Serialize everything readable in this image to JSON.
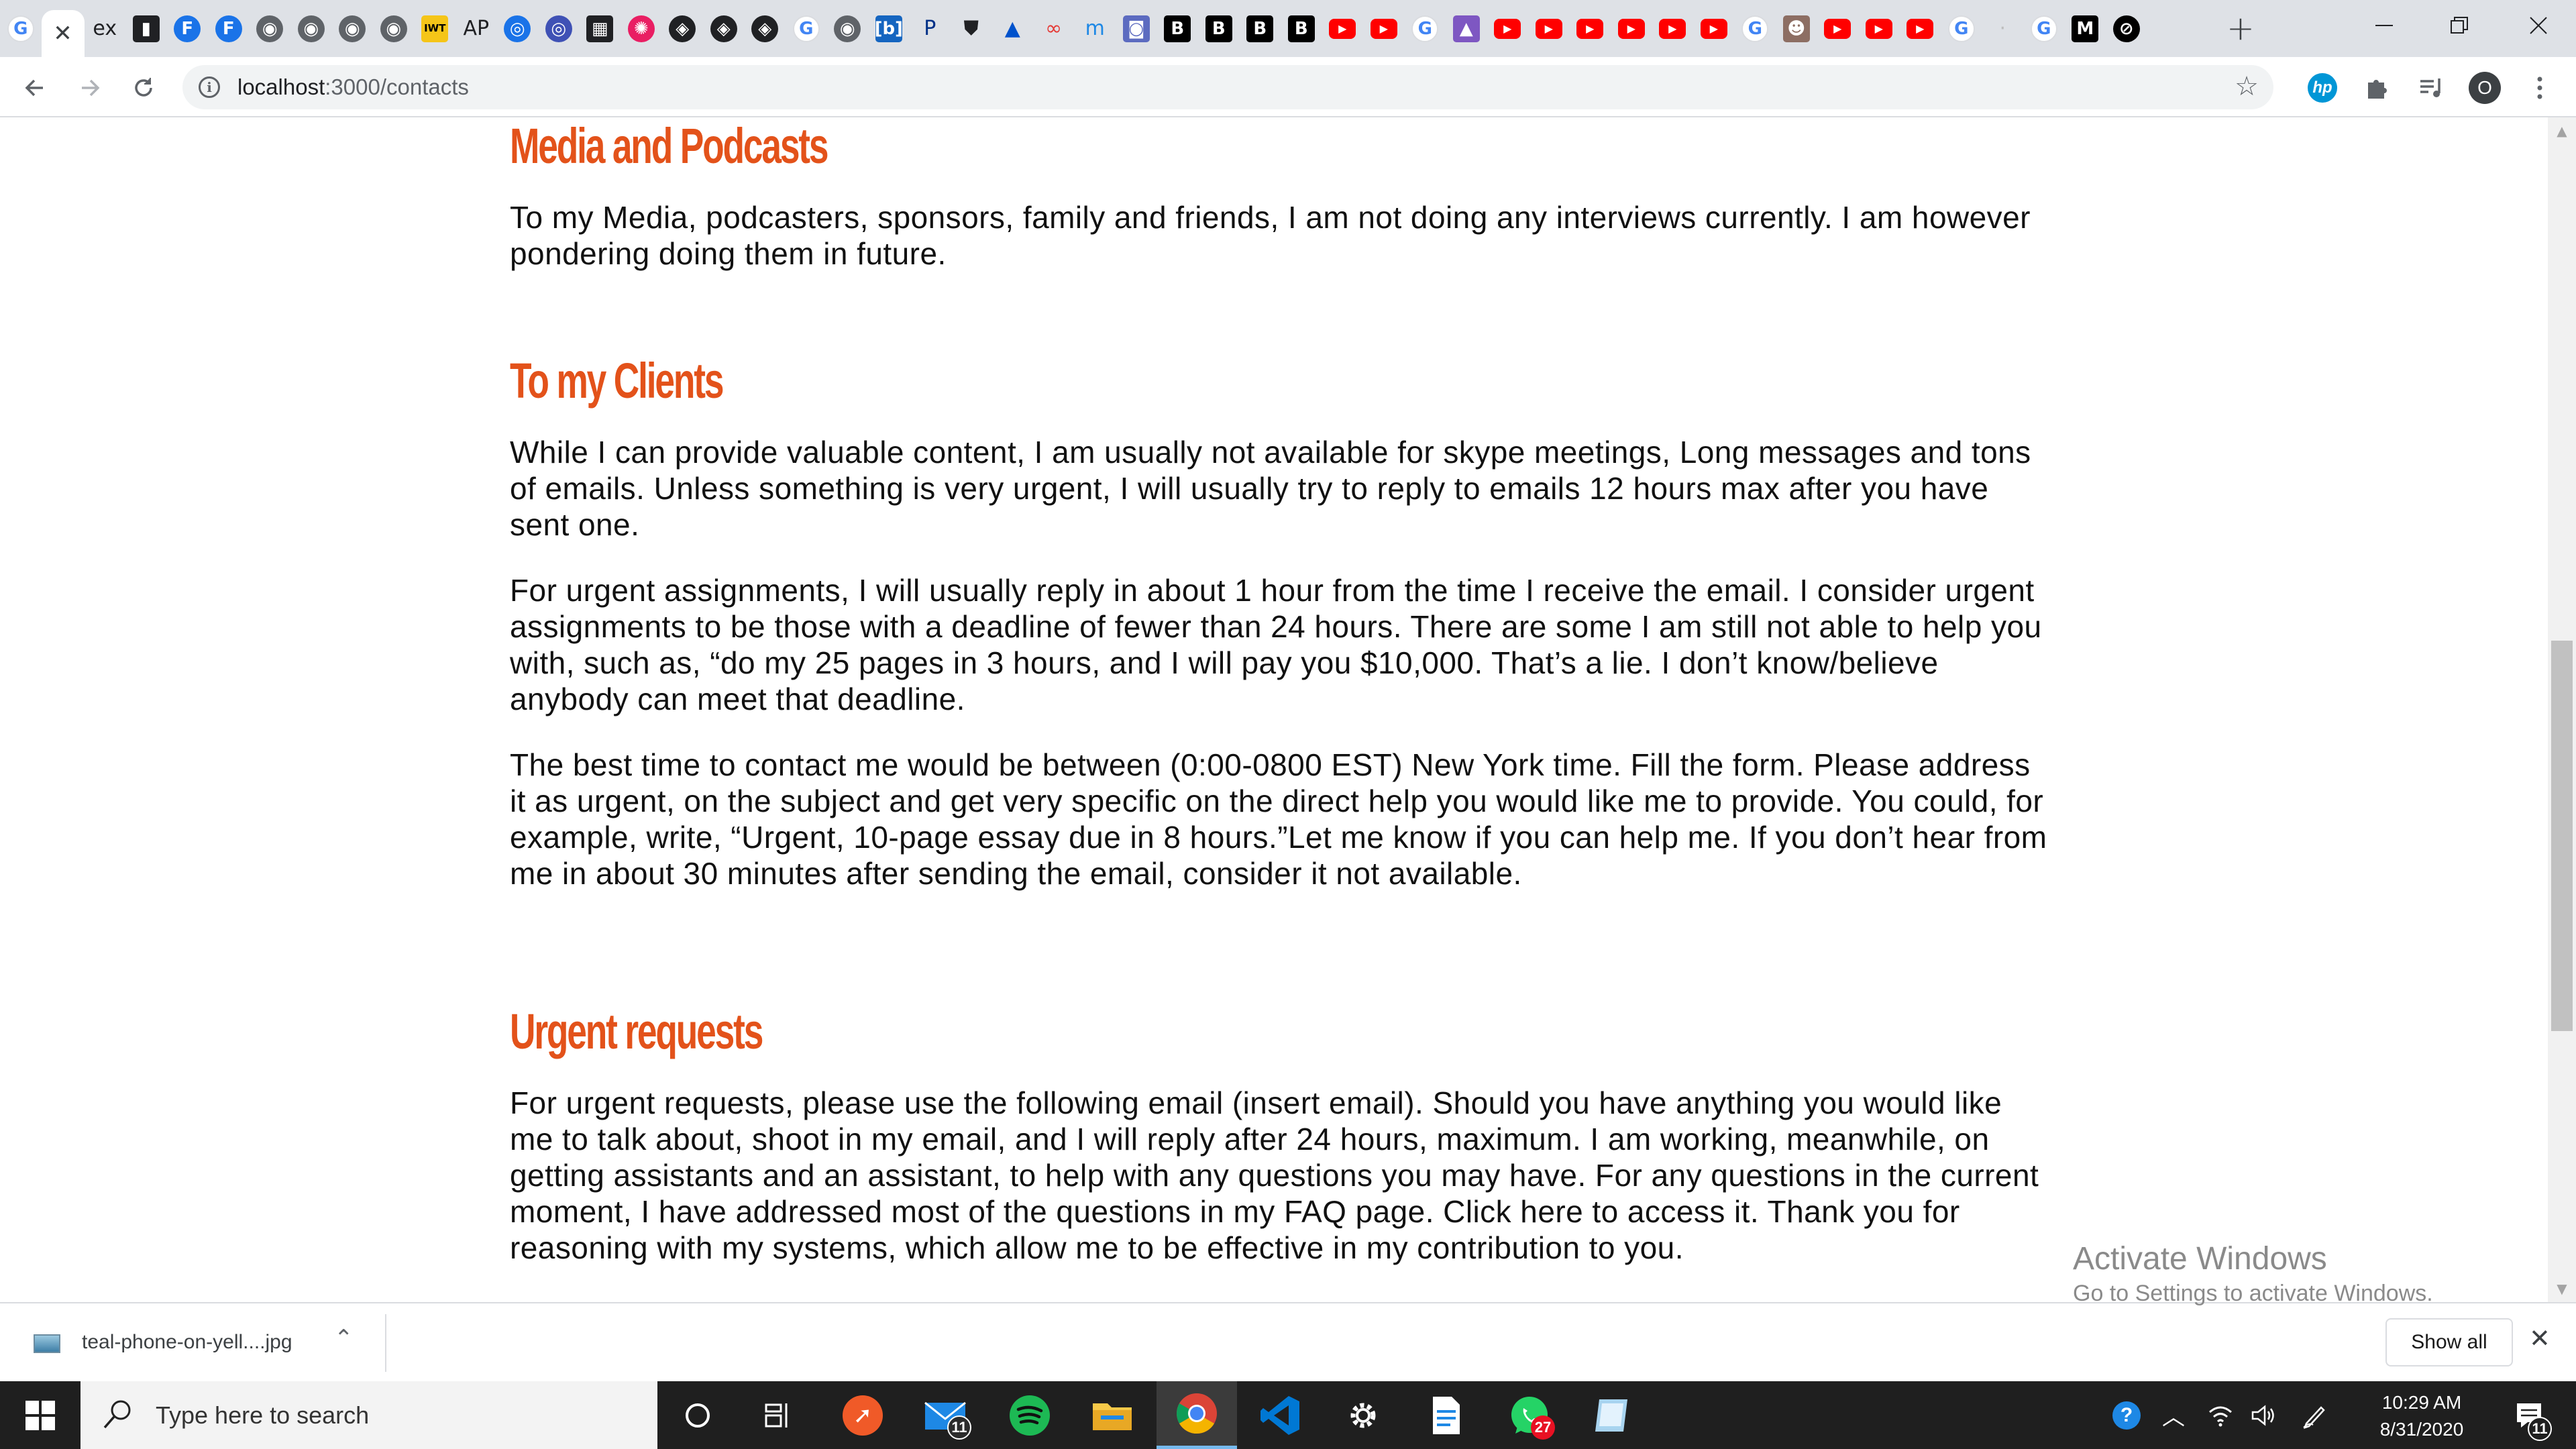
{
  "browser": {
    "tabs": [
      {
        "favicon": "google-icon",
        "glyph": "G",
        "color": "#4285f4",
        "kind": "circle-light"
      },
      {
        "favicon": "close-icon",
        "glyph": "✕",
        "color": "#3c4043",
        "kind": "active"
      },
      {
        "favicon": "ex-icon",
        "glyph": "ex",
        "color": "#202124",
        "kind": "txt"
      },
      {
        "favicon": "bookmark-icon",
        "glyph": "▮",
        "color": "#202124",
        "kind": "sq"
      },
      {
        "favicon": "f-icon",
        "glyph": "F",
        "color": "#1a73e8",
        "kind": "circle"
      },
      {
        "favicon": "f-icon",
        "glyph": "F",
        "color": "#1a73e8",
        "kind": "circle"
      },
      {
        "favicon": "globe-icon",
        "glyph": "◉",
        "color": "#5f6368",
        "kind": "circle"
      },
      {
        "favicon": "globe-icon",
        "glyph": "◉",
        "color": "#5f6368",
        "kind": "circle"
      },
      {
        "favicon": "globe-icon",
        "glyph": "◉",
        "color": "#5f6368",
        "kind": "circle"
      },
      {
        "favicon": "globe-icon",
        "glyph": "◉",
        "color": "#5f6368",
        "kind": "circle"
      },
      {
        "favicon": "iwt-icon",
        "glyph": "IWT",
        "color": "#f5c518",
        "kind": "sq-dark"
      },
      {
        "favicon": "ap-icon",
        "glyph": "AP",
        "color": "#202124",
        "kind": "txt"
      },
      {
        "favicon": "ring-icon",
        "glyph": "◎",
        "color": "#1a73e8",
        "kind": "circle"
      },
      {
        "favicon": "ring-icon",
        "glyph": "◎",
        "color": "#3f51b5",
        "kind": "circle"
      },
      {
        "favicon": "printer-icon",
        "glyph": "▦",
        "color": "#202124",
        "kind": "sq"
      },
      {
        "favicon": "color-wheel-icon",
        "glyph": "✺",
        "color": "#e91e63",
        "kind": "circle"
      },
      {
        "favicon": "codepen-icon",
        "glyph": "◈",
        "color": "#202124",
        "kind": "circle"
      },
      {
        "favicon": "codepen-icon",
        "glyph": "◈",
        "color": "#202124",
        "kind": "circle"
      },
      {
        "favicon": "codepen-icon",
        "glyph": "◈",
        "color": "#202124",
        "kind": "circle"
      },
      {
        "favicon": "google-icon",
        "glyph": "G",
        "color": "#4285f4",
        "kind": "circle-light"
      },
      {
        "favicon": "globe-icon",
        "glyph": "◉",
        "color": "#5f6368",
        "kind": "circle"
      },
      {
        "favicon": "bracket-icon",
        "glyph": "[b]",
        "color": "#1565c0",
        "kind": "sq"
      },
      {
        "favicon": "paypal-icon",
        "glyph": "P",
        "color": "#003087",
        "kind": "txt"
      },
      {
        "favicon": "shield-icon",
        "glyph": "⛊",
        "color": "#202124",
        "kind": "txt"
      },
      {
        "favicon": "atlassian-icon",
        "glyph": "▲",
        "color": "#0052cc",
        "kind": "txt"
      },
      {
        "favicon": "infinity-icon",
        "glyph": "∞",
        "color": "#e53935",
        "kind": "txt"
      },
      {
        "favicon": "m-icon",
        "glyph": "m",
        "color": "#1e88e5",
        "kind": "txt"
      },
      {
        "favicon": "camera-icon",
        "glyph": "◙",
        "color": "#5c6bc0",
        "kind": "sq"
      },
      {
        "favicon": "bbc-icon",
        "glyph": "B",
        "color": "#000000",
        "kind": "sq"
      },
      {
        "favicon": "bbc-icon",
        "glyph": "B",
        "color": "#000000",
        "kind": "sq"
      },
      {
        "favicon": "bbc-icon",
        "glyph": "B",
        "color": "#000000",
        "kind": "sq"
      },
      {
        "favicon": "bbc-icon",
        "glyph": "B",
        "color": "#000000",
        "kind": "sq"
      },
      {
        "favicon": "youtube-icon",
        "glyph": "▶",
        "color": "#ff0000",
        "kind": "yt"
      },
      {
        "favicon": "youtube-icon",
        "glyph": "▶",
        "color": "#ff0000",
        "kind": "yt"
      },
      {
        "favicon": "google-icon",
        "glyph": "G",
        "color": "#4285f4",
        "kind": "circle-light"
      },
      {
        "favicon": "rocket-icon",
        "glyph": "▲",
        "color": "#7e57c2",
        "kind": "sq"
      },
      {
        "favicon": "youtube-icon",
        "glyph": "▶",
        "color": "#ff0000",
        "kind": "yt"
      },
      {
        "favicon": "youtube-icon",
        "glyph": "▶",
        "color": "#ff0000",
        "kind": "yt"
      },
      {
        "favicon": "youtube-icon",
        "glyph": "▶",
        "color": "#ff0000",
        "kind": "yt"
      },
      {
        "favicon": "youtube-icon",
        "glyph": "▶",
        "color": "#ff0000",
        "kind": "yt"
      },
      {
        "favicon": "youtube-icon",
        "glyph": "▶",
        "color": "#ff0000",
        "kind": "yt"
      },
      {
        "favicon": "youtube-icon",
        "glyph": "▶",
        "color": "#ff0000",
        "kind": "yt"
      },
      {
        "favicon": "google-icon",
        "glyph": "G",
        "color": "#4285f4",
        "kind": "circle-light"
      },
      {
        "favicon": "avatar-icon",
        "glyph": "☻",
        "color": "#8d6e63",
        "kind": "sq"
      },
      {
        "favicon": "youtube-icon",
        "glyph": "▶",
        "color": "#ff0000",
        "kind": "yt"
      },
      {
        "favicon": "youtube-icon",
        "glyph": "▶",
        "color": "#ff0000",
        "kind": "yt"
      },
      {
        "favicon": "youtube-icon",
        "glyph": "▶",
        "color": "#ff0000",
        "kind": "yt"
      },
      {
        "favicon": "google-icon",
        "glyph": "G",
        "color": "#4285f4",
        "kind": "circle-light"
      },
      {
        "favicon": "blank-page-icon",
        "glyph": "·",
        "color": "#bdbdbd",
        "kind": "txt"
      },
      {
        "favicon": "google-icon",
        "glyph": "G",
        "color": "#4285f4",
        "kind": "circle-light"
      },
      {
        "favicon": "medium-icon",
        "glyph": "M",
        "color": "#000000",
        "kind": "sq"
      },
      {
        "favicon": "slash-icon",
        "glyph": "⊘",
        "color": "#000000",
        "kind": "circle"
      }
    ],
    "new_tab_label": "+",
    "url_host": "localhost",
    "url_path": ":3000/contacts",
    "profile_initial": "O"
  },
  "page": {
    "sections": [
      {
        "heading": "Media and Podcasts",
        "paragraphs": [
          "To my Media, podcasters, sponsors, family and friends, I am not doing any interviews currently. I am however pondering doing them in future."
        ]
      },
      {
        "heading": "To my Clients",
        "paragraphs": [
          "While I can provide valuable content, I am usually not available for skype meetings, Long messages and tons of emails. Unless something is very urgent, I will usually try to reply to emails 12 hours max after you have sent one.",
          "For urgent assignments, I will usually reply in about 1 hour from the time I receive the email. I consider urgent assignments to be those with a deadline of fewer than 24 hours. There are some I am still not able to help you with, such as, “do my 25 pages in 3 hours, and I will pay you $10,000. That’s a lie. I don’t know/believe anybody can meet that deadline.",
          "The best time to contact me would be between (0:00-0800 EST) New York time. Fill the form. Please address it as urgent, on the subject and get very specific on the direct help you would like me to provide. You could, for example, write, “Urgent, 10-page essay due in 8 hours.”Let me know if you can help me. If you don’t hear from me in about 30 minutes after sending the email, consider it not available."
        ]
      },
      {
        "heading": "Urgent requests",
        "paragraphs": [
          "For urgent requests, please use the following email (insert email). Should you have anything you would like me to talk about, shoot in my email, and I will reply after 24 hours, maximum. I am working, meanwhile, on getting assistants and an assistant, to help with any questions you may have. For any questions in the current moment, I have addressed most of the questions in my FAQ page. Click here to access it. Thank you for reasoning with my systems, which allow me to be effective in my contribution to you."
        ]
      }
    ]
  },
  "watermark": {
    "title": "Activate Windows",
    "subtitle": "Go to Settings to activate Windows."
  },
  "downloads": {
    "filename": "teal-phone-on-yell....jpg",
    "show_all": "Show all"
  },
  "taskbar": {
    "search_placeholder": "Type here to search",
    "mail_badge": "11",
    "whatsapp_badge": "27",
    "time": "10:29 AM",
    "date": "8/31/2020",
    "notifications_badge": "11"
  }
}
